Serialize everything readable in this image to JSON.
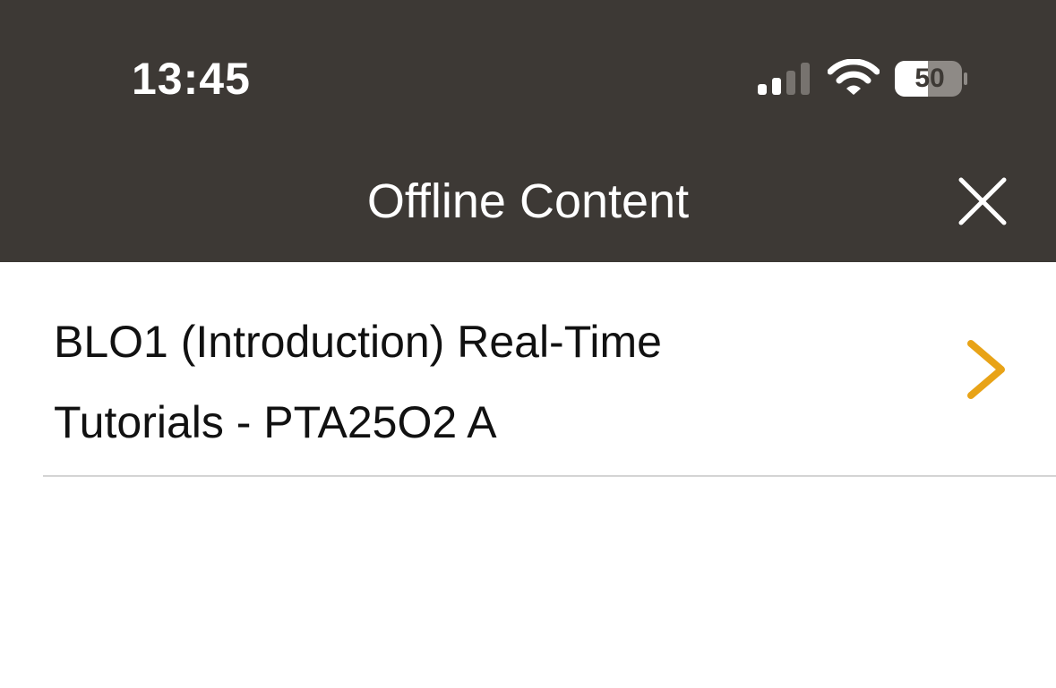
{
  "status_bar": {
    "time": "13:45",
    "battery_level": "50",
    "signal_bars_active": 2,
    "signal_bars_total": 4
  },
  "nav": {
    "title": "Offline Content",
    "close_icon": "close-icon"
  },
  "list": {
    "items": [
      {
        "line1": "BLO1 (Introduction) Real-Time",
        "line2": "Tutorials - PTA25O2 A",
        "icon": "chevron-right-icon"
      }
    ]
  },
  "colors": {
    "header_bg": "#3d3935",
    "accent": "#e8a317",
    "text": "#111111",
    "divider": "#d4d4d4"
  }
}
